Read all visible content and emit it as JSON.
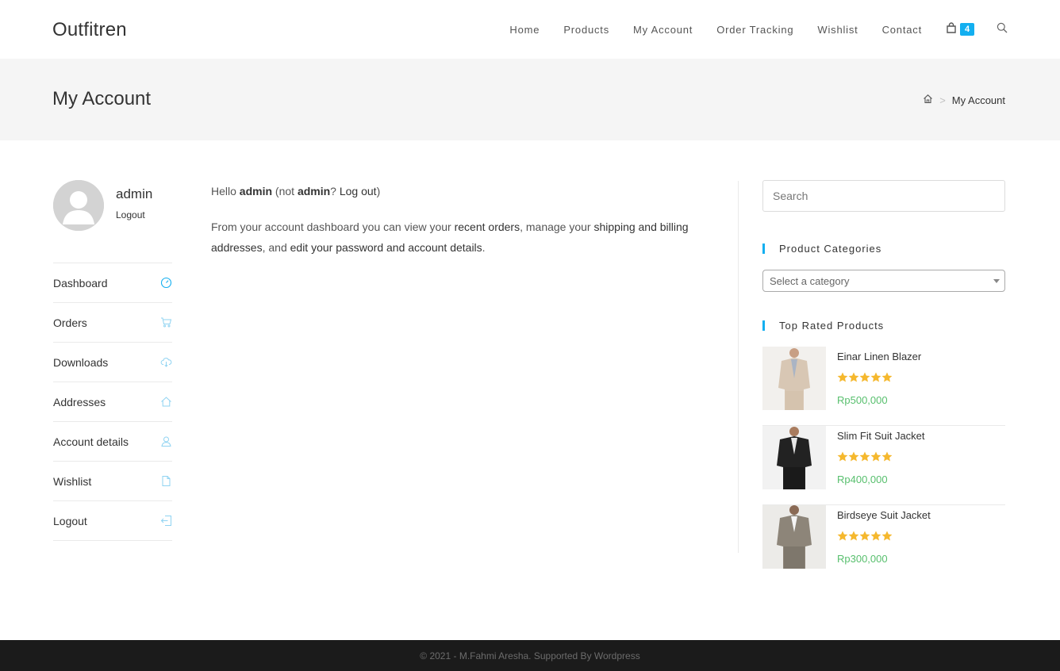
{
  "header": {
    "logo": "Outfitren",
    "nav": [
      "Home",
      "Products",
      "My Account",
      "Order Tracking",
      "Wishlist",
      "Contact"
    ],
    "cart_count": "4",
    "icons": {
      "cart": "shopping-bag-icon",
      "search": "search-icon"
    }
  },
  "page_header": {
    "title": "My Account",
    "breadcrumb": {
      "home_icon": "home-icon",
      "separator": ">",
      "current": "My Account"
    }
  },
  "account": {
    "username": "admin",
    "logout": "Logout",
    "nav": [
      {
        "label": "Dashboard",
        "icon": "speedometer-icon"
      },
      {
        "label": "Orders",
        "icon": "cart-icon"
      },
      {
        "label": "Downloads",
        "icon": "cloud-download-icon"
      },
      {
        "label": "Addresses",
        "icon": "home-icon"
      },
      {
        "label": "Account details",
        "icon": "user-icon"
      },
      {
        "label": "Wishlist",
        "icon": "document-icon"
      },
      {
        "label": "Logout",
        "icon": "logout-icon"
      }
    ]
  },
  "content": {
    "hello_prefix": "Hello ",
    "hello_name": "admin",
    "hello_mid": " (not ",
    "hello_name2": "admin",
    "hello_q": "? ",
    "hello_logout": "Log out",
    "hello_suffix": ")",
    "p2_prefix": "From your account dashboard you can view your ",
    "p2_link1": "recent orders",
    "p2_mid1": ", manage your ",
    "p2_link2": "shipping and billing addresses",
    "p2_mid2": ", and ",
    "p2_link3": "edit your password and account details",
    "p2_suffix": "."
  },
  "sidebar": {
    "search_placeholder": "Search",
    "categories_title": "Product Categories",
    "category_select": "Select a category",
    "top_rated_title": "Top Rated Products",
    "products": [
      {
        "name": "Einar Linen Blazer",
        "price": "Rp500,000",
        "rating": 5
      },
      {
        "name": "Slim Fit Suit Jacket",
        "price": "Rp400,000",
        "rating": 5
      },
      {
        "name": "Birdseye Suit Jacket",
        "price": "Rp300,000",
        "rating": 5
      }
    ]
  },
  "footer": {
    "text": "© 2021 - M.Fahmi Aresha. Supported By Wordpress"
  },
  "colors": {
    "accent": "#13aff0",
    "price": "#57bf6d",
    "star": "#f5b82e",
    "footer_bg": "#1b1b1b"
  }
}
